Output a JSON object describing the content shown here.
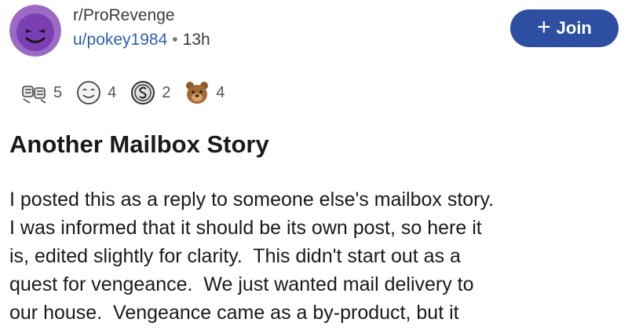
{
  "post_header": {
    "subreddit": "r/ProRevenge",
    "username": "u/pokey1984",
    "separator": "•",
    "age": "13h",
    "avatar_icon": "devil-face-icon",
    "join_label": "Join",
    "join_color": "#2d4ea1"
  },
  "awards": [
    {
      "icon": "fist-bump-icon",
      "count": "5"
    },
    {
      "icon": "wholesome-face-icon",
      "count": "4"
    },
    {
      "icon": "silver-coin-icon",
      "count": "2"
    },
    {
      "icon": "bear-face-icon",
      "count": "4"
    }
  ],
  "post": {
    "title": "Another Mailbox Story",
    "body_lines": [
      "I posted this as a reply to someone else's mailbox story.",
      "I was informed that it should be its own post, so here it",
      "is, edited slightly for clarity.  This didn't start out as a",
      "quest for vengeance.  We just wanted mail delivery to",
      "our house.  Vengeance came as a by-product, but it"
    ]
  }
}
